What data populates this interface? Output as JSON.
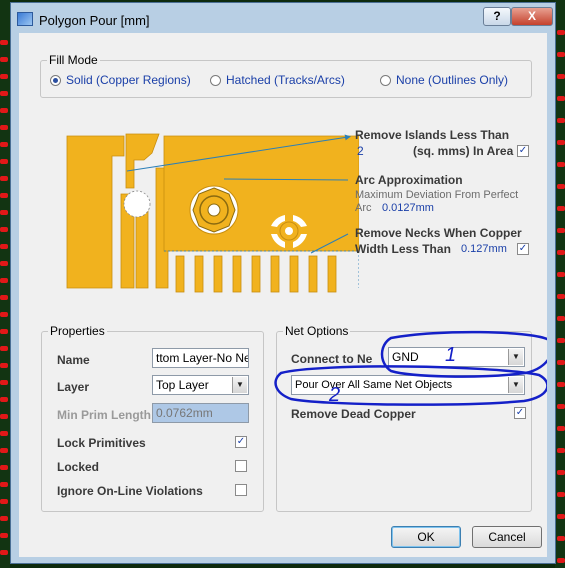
{
  "window": {
    "title": "Polygon Pour [mm]",
    "help_glyph": "?",
    "close_glyph": "X"
  },
  "fill_mode": {
    "label": "Fill Mode",
    "options": [
      {
        "label": "Solid (Copper Regions)",
        "selected": true
      },
      {
        "label": "Hatched (Tracks/Arcs)",
        "selected": false
      },
      {
        "label": "None (Outlines Only)",
        "selected": false
      }
    ]
  },
  "settings": {
    "remove_islands_label": "Remove Islands Less Than",
    "remove_islands_value": "2",
    "remove_islands_unit": "(sq. mms) In Area",
    "remove_islands_checked": true,
    "arc_label": "Arc Approximation",
    "arc_desc_1": "Maximum Deviation From Perfect",
    "arc_desc_2": "Arc",
    "arc_value": "0.0127mm",
    "necks_label_1": "Remove Necks When Copper",
    "necks_label_2": "Width Less Than",
    "necks_value": "0.127mm",
    "necks_checked": true
  },
  "properties": {
    "label": "Properties",
    "name_label": "Name",
    "name_value": "ttom Layer-No Net",
    "layer_label": "Layer",
    "layer_value": "Top Layer",
    "min_prim_label": "Min Prim Length",
    "min_prim_value": "0.0762mm",
    "lock_primitives_label": "Lock Primitives",
    "lock_primitives_checked": true,
    "locked_label": "Locked",
    "locked_checked": false,
    "ignore_label": "Ignore On-Line Violations",
    "ignore_checked": false
  },
  "net_options": {
    "label": "Net Options",
    "connect_label": "Connect to Ne",
    "connect_value": "GND",
    "pour_value": "Pour Over All Same Net Objects",
    "remove_dead_label": "Remove Dead Copper",
    "remove_dead_checked": true
  },
  "annotations": {
    "mark_1": "1",
    "mark_2": "2"
  },
  "buttons": {
    "ok": "OK",
    "cancel": "Cancel"
  },
  "colors": {
    "copper": "#f1b21e",
    "annotation_ink": "#1420c8",
    "accent_text": "#1a3fa8"
  },
  "icons": [
    "polygon-pour-app-icon",
    "help-icon",
    "close-icon",
    "chevron-down-icon",
    "checkmark-icon"
  ]
}
